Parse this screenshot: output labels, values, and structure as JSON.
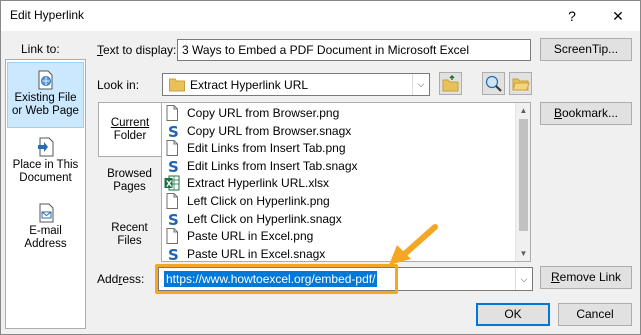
{
  "title": "Edit Hyperlink",
  "title_buttons": {
    "help": "?",
    "close": "✕"
  },
  "link_to": {
    "label": "Link to:",
    "items": [
      {
        "label_line1": "Existing File",
        "label_line2": "or Web Page",
        "icon": "globe-file-icon"
      },
      {
        "label_line1": "Place in This",
        "label_line2": "Document",
        "icon": "document-place-icon"
      },
      {
        "label_line1": "E-mail",
        "label_line2": "Address",
        "icon": "email-icon"
      }
    ]
  },
  "text_to_display": {
    "label": "Text to display:",
    "value": "3 Ways to Embed a PDF Document in Microsoft Excel"
  },
  "screentip_label": "ScreenTip...",
  "look_in": {
    "label": "Look in:",
    "value": "Extract Hyperlink URL"
  },
  "nav": [
    {
      "line1": "Current",
      "line2": "Folder"
    },
    {
      "line1": "Browsed",
      "line2": "Pages"
    },
    {
      "line1": "Recent",
      "line2": "Files"
    }
  ],
  "files": [
    {
      "name": "Copy URL from Browser.png",
      "type": "png"
    },
    {
      "name": "Copy URL from Browser.snagx",
      "type": "snagx"
    },
    {
      "name": "Edit Links from Insert Tab.png",
      "type": "png"
    },
    {
      "name": "Edit Links from Insert Tab.snagx",
      "type": "snagx"
    },
    {
      "name": "Extract Hyperlink URL.xlsx",
      "type": "xlsx"
    },
    {
      "name": "Left Click on Hyperlink.png",
      "type": "png"
    },
    {
      "name": "Left Click on Hyperlink.snagx",
      "type": "snagx"
    },
    {
      "name": "Paste URL in Excel.png",
      "type": "png"
    },
    {
      "name": "Paste URL in Excel.snagx",
      "type": "snagx"
    }
  ],
  "bookmark_label": "Bookmark...",
  "address": {
    "label": "Address:",
    "value": "https://www.howtoexcel.org/embed-pdf/"
  },
  "remove_link_label": "Remove Link",
  "ok_label": "OK",
  "cancel_label": "Cancel",
  "colors": {
    "accent": "#0078d7",
    "selection_bg": "#cce8ff",
    "annotation": "#f5a623",
    "folder": "#e8c15a",
    "excel": "#1d6f42",
    "snagit": "#1d63b8"
  }
}
